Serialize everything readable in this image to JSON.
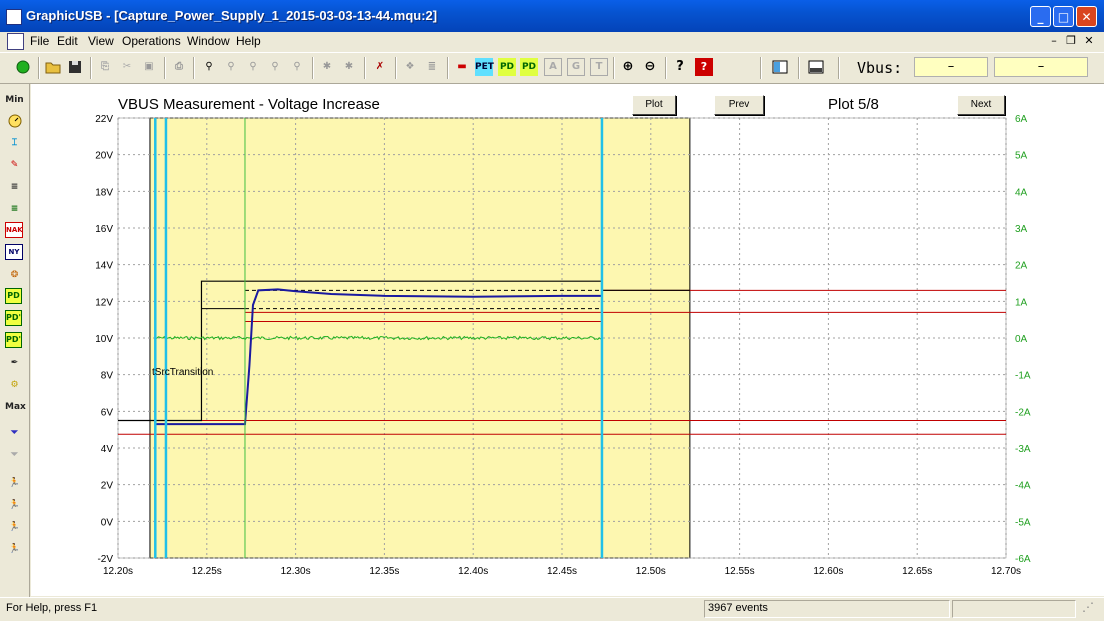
{
  "window": {
    "title": "GraphicUSB - [Capture_Power_Supply_1_2015-03-03-13-44.mqu:2]"
  },
  "menu": {
    "items": [
      "File",
      "Edit",
      "View",
      "Operations",
      "Window",
      "Help"
    ]
  },
  "toolbar": {
    "buttons": [
      "run-icon",
      "open-icon",
      "save-icon",
      "copy-icon",
      "cut-icon",
      "paste-icon",
      "print-icon",
      "find-icon",
      "find-prev-icon",
      "find-next-icon",
      "find-all-icon",
      "filter-icon",
      "filter-off-icon",
      "trigger-icon",
      "export-icon",
      "report-icon",
      "power-icon",
      "PET",
      "PD",
      "PD",
      "A",
      "G",
      "T",
      "zoom-in-icon",
      "zoom-out-icon",
      "help-icon",
      "context-help-icon",
      "split-view-icon",
      "bottom-view-icon"
    ],
    "vbus_label": "Vbus:",
    "vbus_value1": "–",
    "vbus_value2": "–"
  },
  "left_toolbar": {
    "items": [
      "Min",
      "gauge-icon",
      "capture-icon",
      "tag-icon",
      "list-icon",
      "list2-icon",
      "NAK",
      "NY",
      "settings-icon",
      "PD",
      "PD'",
      "PD\"",
      "pen-icon",
      "power-icon",
      "Max",
      "filter-icon",
      "filter-off-icon",
      "walk-icon",
      "walk2-icon",
      "walk3-icon",
      "walk4-icon"
    ]
  },
  "plot": {
    "buttons": {
      "plot": "Plot",
      "prev": "Prev",
      "next": "Next"
    },
    "page_label": "Plot 5/8"
  },
  "chart_data": {
    "type": "line",
    "title": "VBUS Measurement - Voltage Increase",
    "x_ticks": [
      "12.20s",
      "12.25s",
      "12.30s",
      "12.35s",
      "12.40s",
      "12.45s",
      "12.50s",
      "12.55s",
      "12.60s",
      "12.65s",
      "12.70s"
    ],
    "y_left_ticks": [
      "22V",
      "20V",
      "18V",
      "16V",
      "14V",
      "12V",
      "10V",
      "8V",
      "6V",
      "4V",
      "2V",
      "0V",
      "-2V"
    ],
    "y_right_ticks": [
      "6A",
      "5A",
      "4A",
      "3A",
      "2A",
      "1A",
      "0A",
      "-1A",
      "-2A",
      "-3A",
      "-4A",
      "-5A",
      "-6A"
    ],
    "xlim": [
      12.2,
      12.7
    ],
    "ylim_left": [
      -2,
      22
    ],
    "ylim_right": [
      -6,
      6
    ],
    "annotation": "tSrcTransition",
    "shaded_region": {
      "x_start": 12.218,
      "x_end": 12.522,
      "color": "#fdf7b0"
    },
    "markers": [
      {
        "x": 12.221,
        "color": "#20c0e8"
      },
      {
        "x": 12.227,
        "color": "#20c0e8"
      },
      {
        "x": 12.2715,
        "color": "#40c040"
      },
      {
        "x": 12.4725,
        "color": "#20c0e8"
      }
    ],
    "limit_lines": [
      {
        "name": "5V lower",
        "y": 4.75,
        "x_from": 12.2,
        "x_to": 12.7,
        "color": "#c00000"
      },
      {
        "name": "5V upper",
        "y": 5.5,
        "x_from": 12.2,
        "x_to": 12.7,
        "color": "#c00000"
      },
      {
        "name": "12V lower",
        "y": 11.4,
        "x_from": 12.2715,
        "x_to": 12.7,
        "color": "#c00000"
      },
      {
        "name": "12V upper",
        "y": 12.6,
        "x_from": 12.4725,
        "x_to": 12.7,
        "color": "#c00000"
      },
      {
        "name": "12V inner",
        "y": 10.9,
        "x_from": 12.2715,
        "x_to": 12.4725,
        "color": "#c00000"
      }
    ],
    "dashed_lines": [
      {
        "y": 12.6,
        "x_from": 12.2715,
        "x_to": 12.4725
      },
      {
        "y": 11.6,
        "x_from": 12.2715,
        "x_to": 12.4725
      }
    ],
    "envelope": [
      {
        "x": 12.2,
        "y": 5.5
      },
      {
        "x": 12.247,
        "y": 5.5
      },
      {
        "x": 12.247,
        "y": 13.1
      },
      {
        "x": 12.4725,
        "y": 13.1
      },
      {
        "x": 12.4725,
        "y": 12.6
      },
      {
        "x": 12.522,
        "y": 12.6
      }
    ],
    "envelope_lower": [
      {
        "x": 12.247,
        "y": 11.6
      },
      {
        "x": 12.2715,
        "y": 11.6
      },
      {
        "x": 12.2715,
        "y": 13.1
      }
    ],
    "voltage_series": {
      "name": "VBUS",
      "color": "#1a1aa0",
      "points": [
        {
          "x": 12.221,
          "y": 5.3
        },
        {
          "x": 12.2715,
          "y": 5.3
        },
        {
          "x": 12.274,
          "y": 8.5
        },
        {
          "x": 12.276,
          "y": 11.8
        },
        {
          "x": 12.279,
          "y": 12.6
        },
        {
          "x": 12.29,
          "y": 12.65
        },
        {
          "x": 12.3,
          "y": 12.55
        },
        {
          "x": 12.32,
          "y": 12.4
        },
        {
          "x": 12.35,
          "y": 12.3
        },
        {
          "x": 12.4,
          "y": 12.25
        },
        {
          "x": 12.45,
          "y": 12.3
        },
        {
          "x": 12.4725,
          "y": 12.3
        }
      ]
    },
    "current_series": {
      "name": "IBUS",
      "color": "#20b020",
      "points": [
        {
          "x": 12.221,
          "y": 0.0
        },
        {
          "x": 12.4725,
          "y": 0.0
        }
      ]
    }
  },
  "status": {
    "help_text": "For Help, press F1",
    "events": "3967 events"
  }
}
